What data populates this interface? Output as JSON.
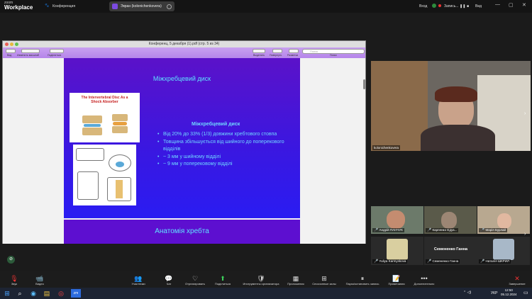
{
  "app": {
    "logo_top": "zoom",
    "logo_bottom": "Workplace",
    "conference_label": "Конференция",
    "share_label": "Экран (kolonichenkovera)",
    "signin_label": "Вход",
    "recording_label": "Запись...",
    "view_label": "Вид"
  },
  "pdf": {
    "title": "Конференц, 5 декабря (1).pdf (стр. 5 из 34)",
    "toolbar_left": [
      "Вид",
      "Изменить масштаб",
      "Поделиться"
    ],
    "toolbar_right": [
      "Выделить",
      "Повернуть",
      "Разметка"
    ],
    "search_label": "Поиск",
    "search_placeholder": "Поиск"
  },
  "slide": {
    "top_title": "Міжхребцевий диск",
    "subtitle": "Міжхребцевий диск",
    "illus_title": "The Intervertebral Disc As a Shock Absorber",
    "bullets": [
      "Від 20% до 33% (1/3) довжини хребтового стовпа",
      "Товщина збільшується від шийного до поперекового відділів",
      "~ 3 мм у шийному відділі",
      "~ 9 мм у поперековому відділі"
    ],
    "next_title": "Анатомія хребта"
  },
  "participants": {
    "main_name": "kolonichenkovera",
    "tiles": [
      {
        "name": "Андрій ПАНЧУК"
      },
      {
        "name": "Карпенко Едуа..."
      },
      {
        "name": "Марія Бурлай"
      },
      {
        "name": "Yuliya Karmyskova"
      },
      {
        "name": "Семененко Ганна"
      },
      {
        "name": "Наталія ШКРИЛ"
      }
    ],
    "center_name": "Семененко Ганна"
  },
  "controls": [
    {
      "label": "Звук",
      "icon": "🎙"
    },
    {
      "label": "Видео",
      "icon": "📹"
    },
    {
      "label": "Участники",
      "icon": "👥"
    },
    {
      "label": "Чат",
      "icon": "💬"
    },
    {
      "label": "Отреагировать",
      "icon": "♡"
    },
    {
      "label": "Поделиться",
      "icon": "⬆"
    },
    {
      "label": "Инструменты организатора",
      "icon": "🛡"
    },
    {
      "label": "Приложения",
      "icon": "▦"
    },
    {
      "label": "Сессионные залы",
      "icon": "⊞"
    },
    {
      "label": "Пауза/остановить запись",
      "icon": "⏸"
    },
    {
      "label": "Примечания",
      "icon": "📝"
    },
    {
      "label": "Дополнительно",
      "icon": "•••"
    },
    {
      "label": "Завершение",
      "icon": "✕"
    }
  ],
  "taskbar": {
    "lang": "УКР",
    "time": "12:50",
    "date": "05.12.2024"
  }
}
